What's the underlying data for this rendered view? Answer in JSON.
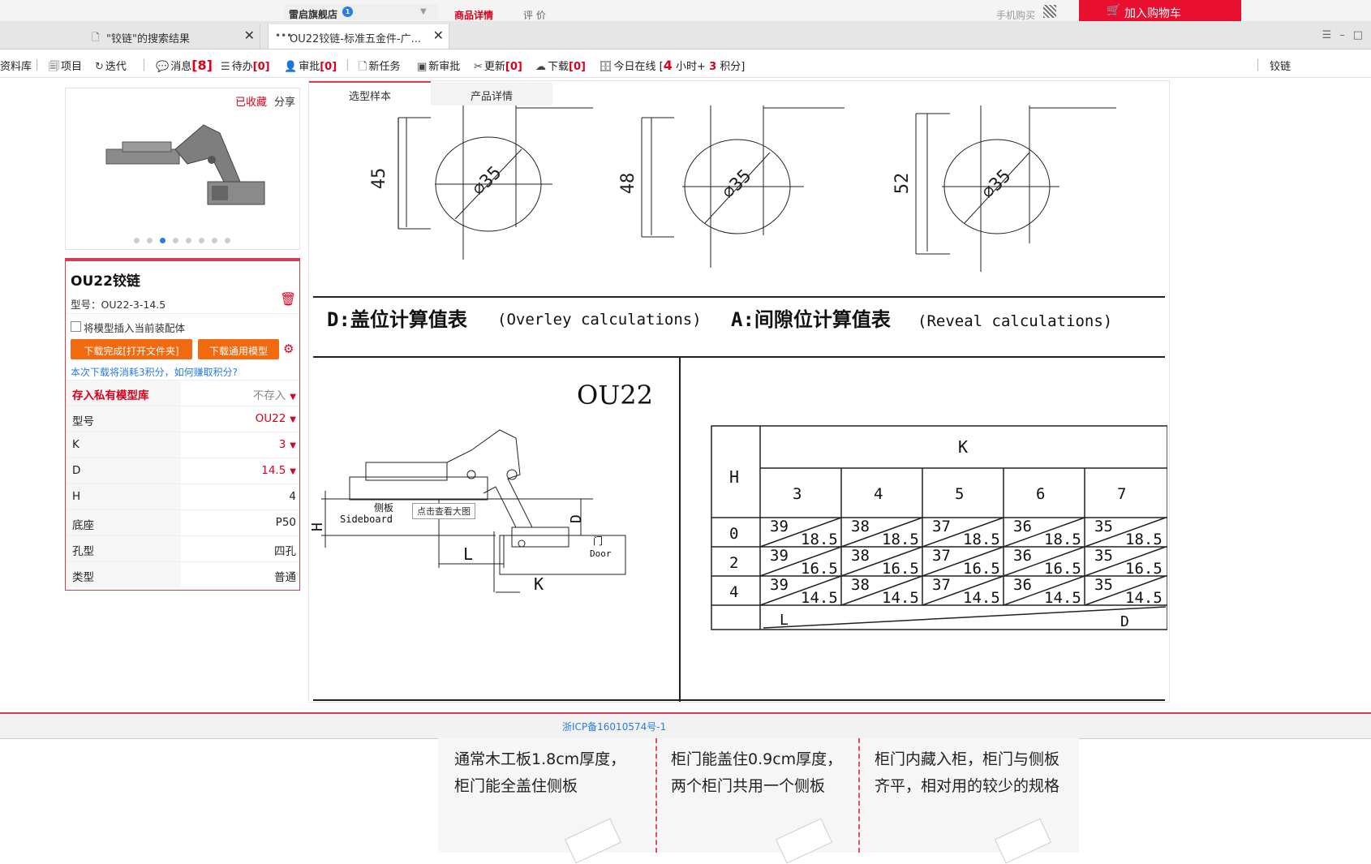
{
  "store": {
    "name": "雷启旗舰店",
    "badge": "1",
    "tabs": [
      "商品详情",
      "评 价"
    ],
    "mobile_buy": "手机购买",
    "add_cart": "加入购物车"
  },
  "browser_tabs": [
    {
      "label": "\"铰链\"的搜索结果"
    },
    {
      "label": "OU22铰链-标准五金件-广..."
    }
  ],
  "toolbar": {
    "items": [
      {
        "label": "资料库"
      },
      {
        "label": "项目"
      },
      {
        "label": "迭代"
      },
      {
        "label": "消息",
        "count": "8"
      },
      {
        "label": "待办",
        "count": "[0]"
      },
      {
        "label": "审批",
        "count": "[0]"
      },
      {
        "label": "新任务"
      },
      {
        "label": "新审批"
      },
      {
        "label": "更新",
        "count": "[0]"
      },
      {
        "label": "下载",
        "count": "[0]"
      }
    ],
    "online": {
      "prefix": "今日在线 [",
      "hours": "4",
      "mid": "小时+",
      "points": "3",
      "suffix": "积分]"
    },
    "search_text": "铰链"
  },
  "product": {
    "favorited": "已收藏",
    "share": "分享",
    "title": "OU22铰链",
    "model_line": "型号：OU22-3-14.5",
    "insert_label": "将模型插入当前装配体",
    "download_done": "下载完成[打开文件夹]",
    "download_generic": "下载通用模型",
    "points_note": "本次下载将消耗3积分，如何赚取积分?",
    "props": [
      {
        "key": "存入私有模型库",
        "value": "不存入"
      },
      {
        "key": "型号",
        "value": "OU22"
      },
      {
        "key": "K",
        "value": "3"
      },
      {
        "key": "D",
        "value": "14.5"
      },
      {
        "key": "H",
        "value": "4"
      },
      {
        "key": "底座",
        "value": "P50"
      },
      {
        "key": "孔型",
        "value": "四孔"
      },
      {
        "key": "类型",
        "value": "普通"
      }
    ]
  },
  "content_tabs": [
    "选型样本",
    "产品详情"
  ],
  "drawing": {
    "circles": [
      {
        "height": "45",
        "dia": "⌀35"
      },
      {
        "height": "48",
        "dia": "⌀35"
      },
      {
        "height": "52",
        "dia": "⌀35"
      }
    ],
    "overlay_heading": "D:盖位计算值表",
    "overlay_en": "(Overley calculations)",
    "reveal_heading": "A:间隙位计算值表",
    "reveal_en": "(Reveal calculations)",
    "model": "OU22",
    "sideboard_cn": "侧板",
    "sideboard_en": "Sideboard",
    "door_cn": "门",
    "door_en": "Door",
    "dim_h": "H",
    "dim_l": "L",
    "dim_d": "D",
    "dim_k": "K",
    "tooltip": "点击查看大图",
    "table": {
      "h_label": "H",
      "k_label": "K",
      "k_values": [
        "3",
        "4",
        "5",
        "6",
        "7"
      ],
      "rows": [
        {
          "h": "0",
          "cells": [
            [
              "39",
              "18.5"
            ],
            [
              "38",
              "18.5"
            ],
            [
              "37",
              "18.5"
            ],
            [
              "36",
              "18.5"
            ],
            [
              "35",
              "18.5"
            ]
          ]
        },
        {
          "h": "2",
          "cells": [
            [
              "39",
              "16.5"
            ],
            [
              "38",
              "16.5"
            ],
            [
              "37",
              "16.5"
            ],
            [
              "36",
              "16.5"
            ],
            [
              "35",
              "16.5"
            ]
          ]
        },
        {
          "h": "4",
          "cells": [
            [
              "39",
              "14.5"
            ],
            [
              "38",
              "14.5"
            ],
            [
              "37",
              "14.5"
            ],
            [
              "36",
              "14.5"
            ],
            [
              "35",
              "14.5"
            ]
          ]
        }
      ],
      "l_label": "L",
      "d_label": "D"
    }
  },
  "footer": {
    "icp": "浙ICP备16010574号-1"
  },
  "below": {
    "col1": "通常木工板1.8cm厚度，柜门能全盖住侧板",
    "col2": "柜门能盖住0.9cm厚度，两个柜门共用一个侧板",
    "col3": "柜门内藏入柜，柜门与侧板齐平，相对用的较少的规格"
  }
}
